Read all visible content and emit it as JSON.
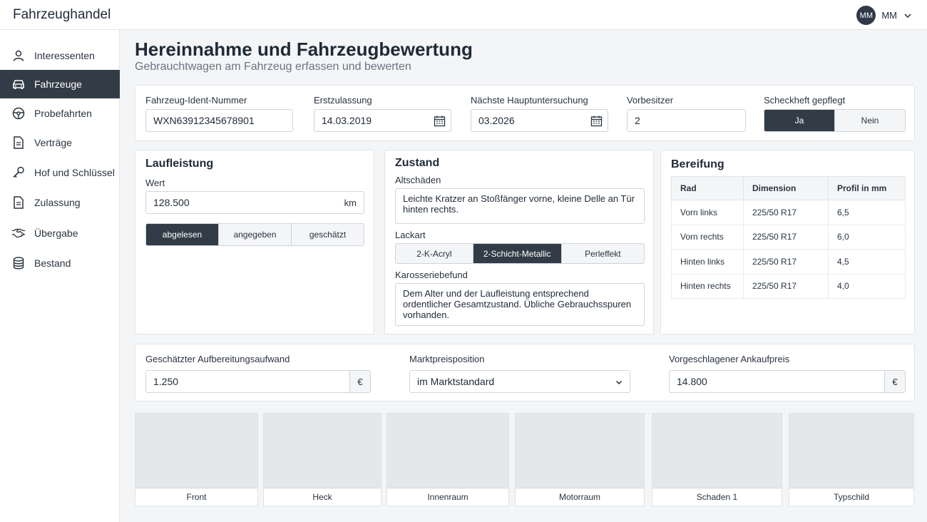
{
  "app": {
    "title": "Fahrzeughandel"
  },
  "user": {
    "initials": "MM",
    "name": "MM"
  },
  "sidebar": {
    "items": [
      {
        "label": "Interessenten",
        "icon": "person-icon",
        "active": false
      },
      {
        "label": "Fahrzeuge",
        "icon": "car-icon",
        "active": true
      },
      {
        "label": "Probefahrten",
        "icon": "steering-wheel-icon",
        "active": false
      },
      {
        "label": "Verträge",
        "icon": "document-icon",
        "active": false
      },
      {
        "label": "Hof und Schlüssel",
        "icon": "key-icon",
        "active": false
      },
      {
        "label": "Zulassung",
        "icon": "document-icon",
        "active": false
      },
      {
        "label": "Übergabe",
        "icon": "handshake-icon",
        "active": false
      },
      {
        "label": "Bestand",
        "icon": "database-icon",
        "active": false
      }
    ]
  },
  "page": {
    "title": "Hereinnahme und Fahrzeugbewertung",
    "subtitle": "Gebrauchtwagen am Fahrzeug erfassen und bewerten"
  },
  "vehicle": {
    "vin_label": "Fahrzeug-Ident-Nummer",
    "vin": "WXN63912345678901",
    "first_reg_label": "Erstzulassung",
    "first_reg": "14.03.2019",
    "next_inspection_label": "Nächste Hauptuntersuchung",
    "next_inspection": "03.2026",
    "previous_owners_label": "Vorbesitzer",
    "previous_owners": "2",
    "service_book_label": "Scheckheft gepflegt",
    "service_book_options": [
      "Ja",
      "Nein"
    ],
    "service_book_selected": "Ja"
  },
  "mileage": {
    "title": "Laufleistung",
    "value_label": "Wert",
    "value": "128.500",
    "unit": "km",
    "source_options": [
      "abgelesen",
      "angegeben",
      "geschätzt"
    ],
    "source_selected": "abgelesen"
  },
  "condition": {
    "title": "Zustand",
    "damage_label": "Altschäden",
    "damage_text": "Leichte Kratzer an Stoßfänger vorne, kleine Delle an Tür hinten rechts.",
    "paint_label": "Lackart",
    "paint_options": [
      "2-K-Acryl",
      "2-Schicht-Metallic",
      "Perleffekt"
    ],
    "paint_selected": "2-Schicht-Metallic",
    "body_label": "Karosseriebefund",
    "body_text": "Dem Alter und der Laufleistung entsprechend ordentlicher Gesamtzustand. Übliche Gebrauchsspuren vorhanden."
  },
  "tires": {
    "title": "Bereifung",
    "headers": [
      "Rad",
      "Dimension",
      "Profil in mm"
    ],
    "rows": [
      [
        "Vorn links",
        "225/50 R17",
        "6,5"
      ],
      [
        "Vorn rechts",
        "225/50 R17",
        "6,0"
      ],
      [
        "Hinten links",
        "225/50 R17",
        "4,5"
      ],
      [
        "Hinten rechts",
        "225/50 R17",
        "4,0"
      ]
    ]
  },
  "valuation": {
    "prep_label": "Geschätzter Aufbereitungsaufwand",
    "prep_value": "1.250",
    "currency": "€",
    "market_label": "Marktpreisposition",
    "market_value": "im Marktstandard",
    "price_label": "Vorgeschlagener Ankaufpreis",
    "price_value": "14.800"
  },
  "photos": [
    "Front",
    "Heck",
    "Innenraum",
    "Motorraum",
    "Schaden 1",
    "Typschild"
  ]
}
